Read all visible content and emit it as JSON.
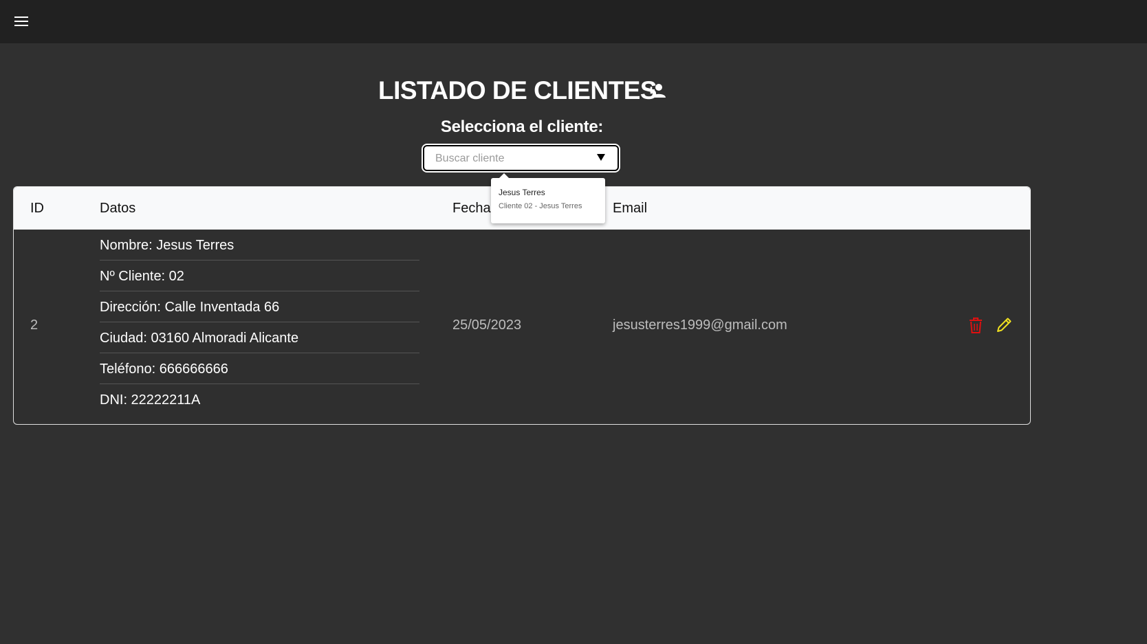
{
  "header": {
    "menu_icon": "hamburger-menu-icon"
  },
  "page": {
    "title": "LISTADO DE CLIENTES",
    "add_icon": "person-add-icon",
    "subtitle": "Selecciona el cliente:"
  },
  "search": {
    "placeholder": "Buscar cliente",
    "caret_icon": "triangle-down-icon"
  },
  "dropdown": {
    "options": [
      {
        "name": "Jesus Terres",
        "detail": "Cliente 02 - Jesus Terres"
      }
    ]
  },
  "table": {
    "headers": [
      "ID",
      "Datos",
      "Fecha",
      "Email"
    ],
    "rows": [
      {
        "id": "2",
        "datos": [
          "Nombre: Jesus Terres",
          "Nº Cliente: 02",
          "Dirección: Calle Inventada 66",
          "Ciudad: 03160 Almoradi Alicante",
          "Teléfono: 666666666",
          "DNI: 22222211A"
        ],
        "fecha": "25/05/2023",
        "email": "jesusterres1999@gmail.com",
        "actions": {
          "delete_icon": "trash-icon",
          "edit_icon": "pencil-icon"
        }
      }
    ]
  },
  "colors": {
    "background": "#303030",
    "topbar": "#212121",
    "header_row": "#f8f9fa",
    "delete": "#e01010",
    "edit": "#f0e020"
  }
}
